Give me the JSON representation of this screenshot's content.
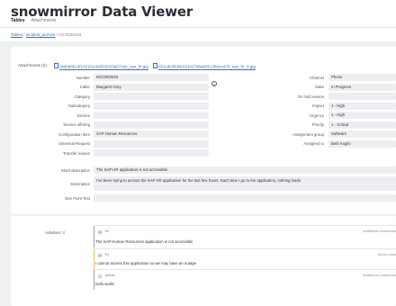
{
  "header": {
    "brand": "snowmirror",
    "app_title": "Data Viewer",
    "tabs": [
      {
        "label": "Tables",
        "active": true
      },
      {
        "label": "Attachments",
        "active": false
      }
    ]
  },
  "breadcrumb": {
    "root": "Tables",
    "table": "incident_archive",
    "record": "INC0000033",
    "sep": "/"
  },
  "attachments": {
    "label": "Attachments (2):",
    "files": [
      "2bdcb6b10f102101c9d202020a674cb_san_hr.jpg",
      "051cdc0f1fd102102786ab0512b0ecd70_san_hr_8.jpg"
    ]
  },
  "form_left": [
    {
      "label": "Number",
      "value": "INC0000033"
    },
    {
      "label": "Caller",
      "value": "Margaret Grey"
    },
    {
      "label": "Category",
      "value": ""
    },
    {
      "label": "Subcategory",
      "value": ""
    },
    {
      "label": "Service",
      "value": ""
    },
    {
      "label": "Service offering",
      "value": ""
    },
    {
      "label": "Configuration item",
      "value": "SAP Human Resources"
    },
    {
      "label": "Universal Request",
      "value": ""
    },
    {
      "label": "Transfer reason",
      "value": ""
    }
  ],
  "form_right": [
    {
      "label": "Channel",
      "value": "Phone"
    },
    {
      "label": "State",
      "value": "In Progress"
    },
    {
      "label": "On hold reason",
      "value": ""
    },
    {
      "label": "Impact",
      "value": "1 - High"
    },
    {
      "label": "Urgency",
      "value": "1 - High"
    },
    {
      "label": "Priority",
      "value": "1 - Critical"
    },
    {
      "label": "Assignment group",
      "value": "Software"
    },
    {
      "label": "Assigned to",
      "value": "Beth Anglin"
    }
  ],
  "wide": [
    {
      "label": "Short description",
      "value": "The SAP HR application is not accessible"
    },
    {
      "label": "Description",
      "value": "I've been trying to access the SAP HR application for the last few hours. Each time I go to the application, nothing loads."
    },
    {
      "label": "Dev Point Test",
      "value": ""
    }
  ],
  "info_icon": "i",
  "activities": {
    "label": "Activities: 3",
    "entries": [
      {
        "initials": "BI",
        "author": "BI",
        "type": "Additional comments",
        "text": "The SAP Human Resources application is not accessible",
        "color": "#9aa0a6"
      },
      {
        "initials": "BI",
        "author": "BI",
        "type": "Work notes",
        "text": "I cannot access this application so we may have an outage",
        "color": "#e7c34a"
      },
      {
        "initials": "A",
        "author": "admin",
        "type": "Additional comments",
        "text": "hello world",
        "color": "#9aa0a6"
      }
    ]
  }
}
